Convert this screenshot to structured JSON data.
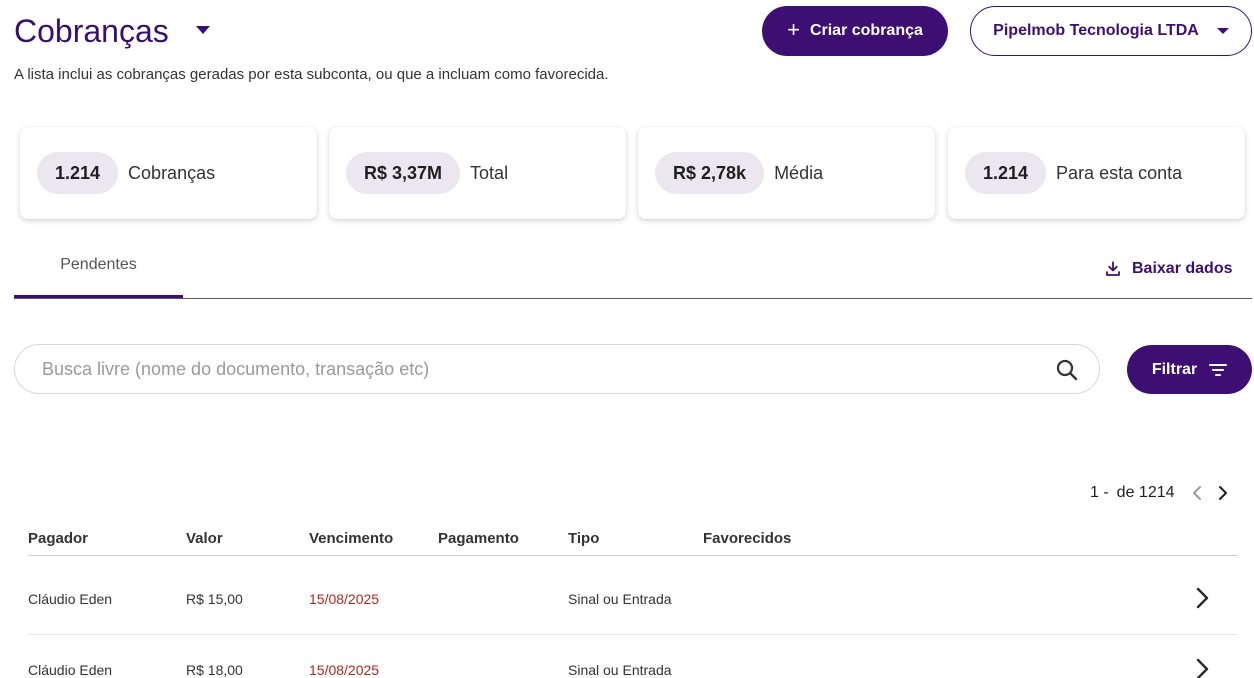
{
  "header": {
    "title": "Cobranças",
    "subtitle": "A lista inclui as cobranças geradas por esta subconta, ou que a incluam como favorecida.",
    "create_label": "Criar cobrança",
    "account_label": "Pipelmob Tecnologia LTDA"
  },
  "stats": [
    {
      "value": "1.214",
      "label": "Cobranças"
    },
    {
      "value": "R$ 3,37M",
      "label": "Total"
    },
    {
      "value": "R$ 2,78k",
      "label": "Média"
    },
    {
      "value": "1.214",
      "label": "Para esta conta"
    }
  ],
  "tabs": {
    "active": "Pendentes",
    "download_label": "Baixar dados"
  },
  "search": {
    "placeholder": "Busca livre (nome do documento, transação etc)",
    "value": "",
    "filter_label": "Filtrar"
  },
  "pagination": {
    "range": "1 -",
    "total": "de 1214"
  },
  "table": {
    "columns": [
      "Pagador",
      "Valor",
      "Vencimento",
      "Pagamento",
      "Tipo",
      "Favorecidos"
    ],
    "rows": [
      {
        "pagador": "Cláudio Eden",
        "valor": "R$ 15,00",
        "vencimento": "15/08/2025",
        "pagamento": "",
        "tipo": "Sinal ou Entrada",
        "favorecidos": ""
      },
      {
        "pagador": "Cláudio Eden",
        "valor": "R$ 18,00",
        "vencimento": "15/08/2025",
        "pagamento": "",
        "tipo": "Sinal ou Entrada",
        "favorecidos": ""
      }
    ]
  },
  "colors": {
    "brand": "#3d0f73",
    "pill_bg": "#ece6f0",
    "due_overdue": "#b3261e"
  },
  "icons": [
    "chevron-down-icon",
    "plus-icon",
    "download-icon",
    "search-icon",
    "filter-icon",
    "chevron-left-icon",
    "chevron-right-icon"
  ]
}
